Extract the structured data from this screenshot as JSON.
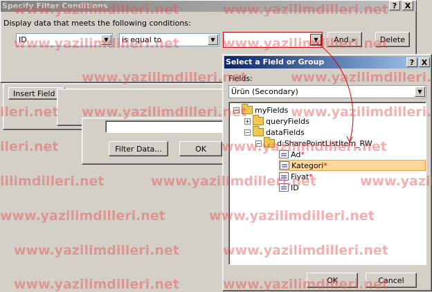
{
  "back_dialog": {
    "title": "Specify Filter Conditions",
    "help_btn": "?",
    "close_btn": "X",
    "instruction": "Display data that meets the following conditions:",
    "field_combo": "ID",
    "operator_combo": "is equal to",
    "value_combo": "",
    "and_button": "And »",
    "delete_button": "Delete"
  },
  "under_dialog": {
    "insert_field_button": "Insert Field o",
    "filter_data_button": "Filter Data...",
    "ok_button": "OK"
  },
  "front_dialog": {
    "title": "Select a Field or Group",
    "help_btn": "?",
    "close_btn": "X",
    "fields_label": "Fields:",
    "data_source": "Ürün (Secondary)",
    "tree": {
      "root": "myFields",
      "query_fields": "queryFields",
      "data_fields": "dataFields",
      "list_item": "d:SharePointListItem_RW",
      "items": [
        {
          "label": "Ad",
          "required": "*"
        },
        {
          "label": "Kategori",
          "required": "*"
        },
        {
          "label": "Fiyat",
          "required": "*"
        },
        {
          "label": "ID",
          "required": ""
        }
      ]
    },
    "ok_button": "OK",
    "cancel_button": "Cancel"
  },
  "watermark": "www.yazilimdilleri.net",
  "watermark_left_fragment": "ileri.net",
  "watermark_left_fragment2": "lilimdilleri.net",
  "colors": {
    "active_title": "#0a246a",
    "inactive_title": "#808080",
    "selection": "#ffd89a",
    "watermark": "#e65050"
  }
}
